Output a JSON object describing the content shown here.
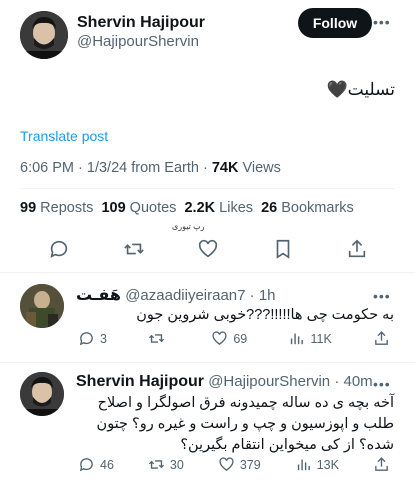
{
  "main_tweet": {
    "author_name": "Shervin Hajipour",
    "author_handle": "@HajipourShervin",
    "follow_label": "Follow",
    "more_label": "•••",
    "text": "تسلیت🖤",
    "translate_label": "Translate post",
    "time": "6:06 PM",
    "date": "1/3/24",
    "source": "from Earth",
    "views_count": "74K",
    "views_label": "Views",
    "stats": {
      "reposts_count": "99",
      "reposts_label": "Reposts",
      "quotes_count": "109",
      "quotes_label": "Quotes",
      "likes_count": "2.2K",
      "likes_label": "Likes",
      "bookmarks_count": "26",
      "bookmarks_label": "Bookmarks"
    },
    "caption_tag": "رپ تیوری"
  },
  "replies": [
    {
      "author_name": "هَفـت",
      "author_handle": "@azaadiiyeiraan7",
      "time": "1h",
      "text": "به حکومت چی ها!!!!!???خوبی شروین جون",
      "replies": "3",
      "reposts": "",
      "likes": "69",
      "views": "11K",
      "more_label": "•••"
    },
    {
      "author_name": "Shervin Hajipour",
      "author_handle": "@HajipourShervin",
      "time": "40m",
      "text_lines": [
        "آخه بچه ی ده ساله چمیدونه فرق اصولگرا و اصلاح",
        "طلب و اپوزسیون و چپ و راست و غیره رو؟ چتون",
        "شده؟ از کی میخواین انتقام بگیرین؟"
      ],
      "replies": "46",
      "reposts": "30",
      "likes": "379",
      "views": "13K",
      "more_label": "•••"
    }
  ],
  "icons": [
    "comment-icon",
    "repost-icon",
    "heart-icon",
    "bookmark-icon",
    "share-icon",
    "views-icon"
  ],
  "colors": {
    "primary_text": "#0f1419",
    "secondary_text": "#536471",
    "link": "#1d9bf0",
    "follow_bg": "#0f1419"
  }
}
